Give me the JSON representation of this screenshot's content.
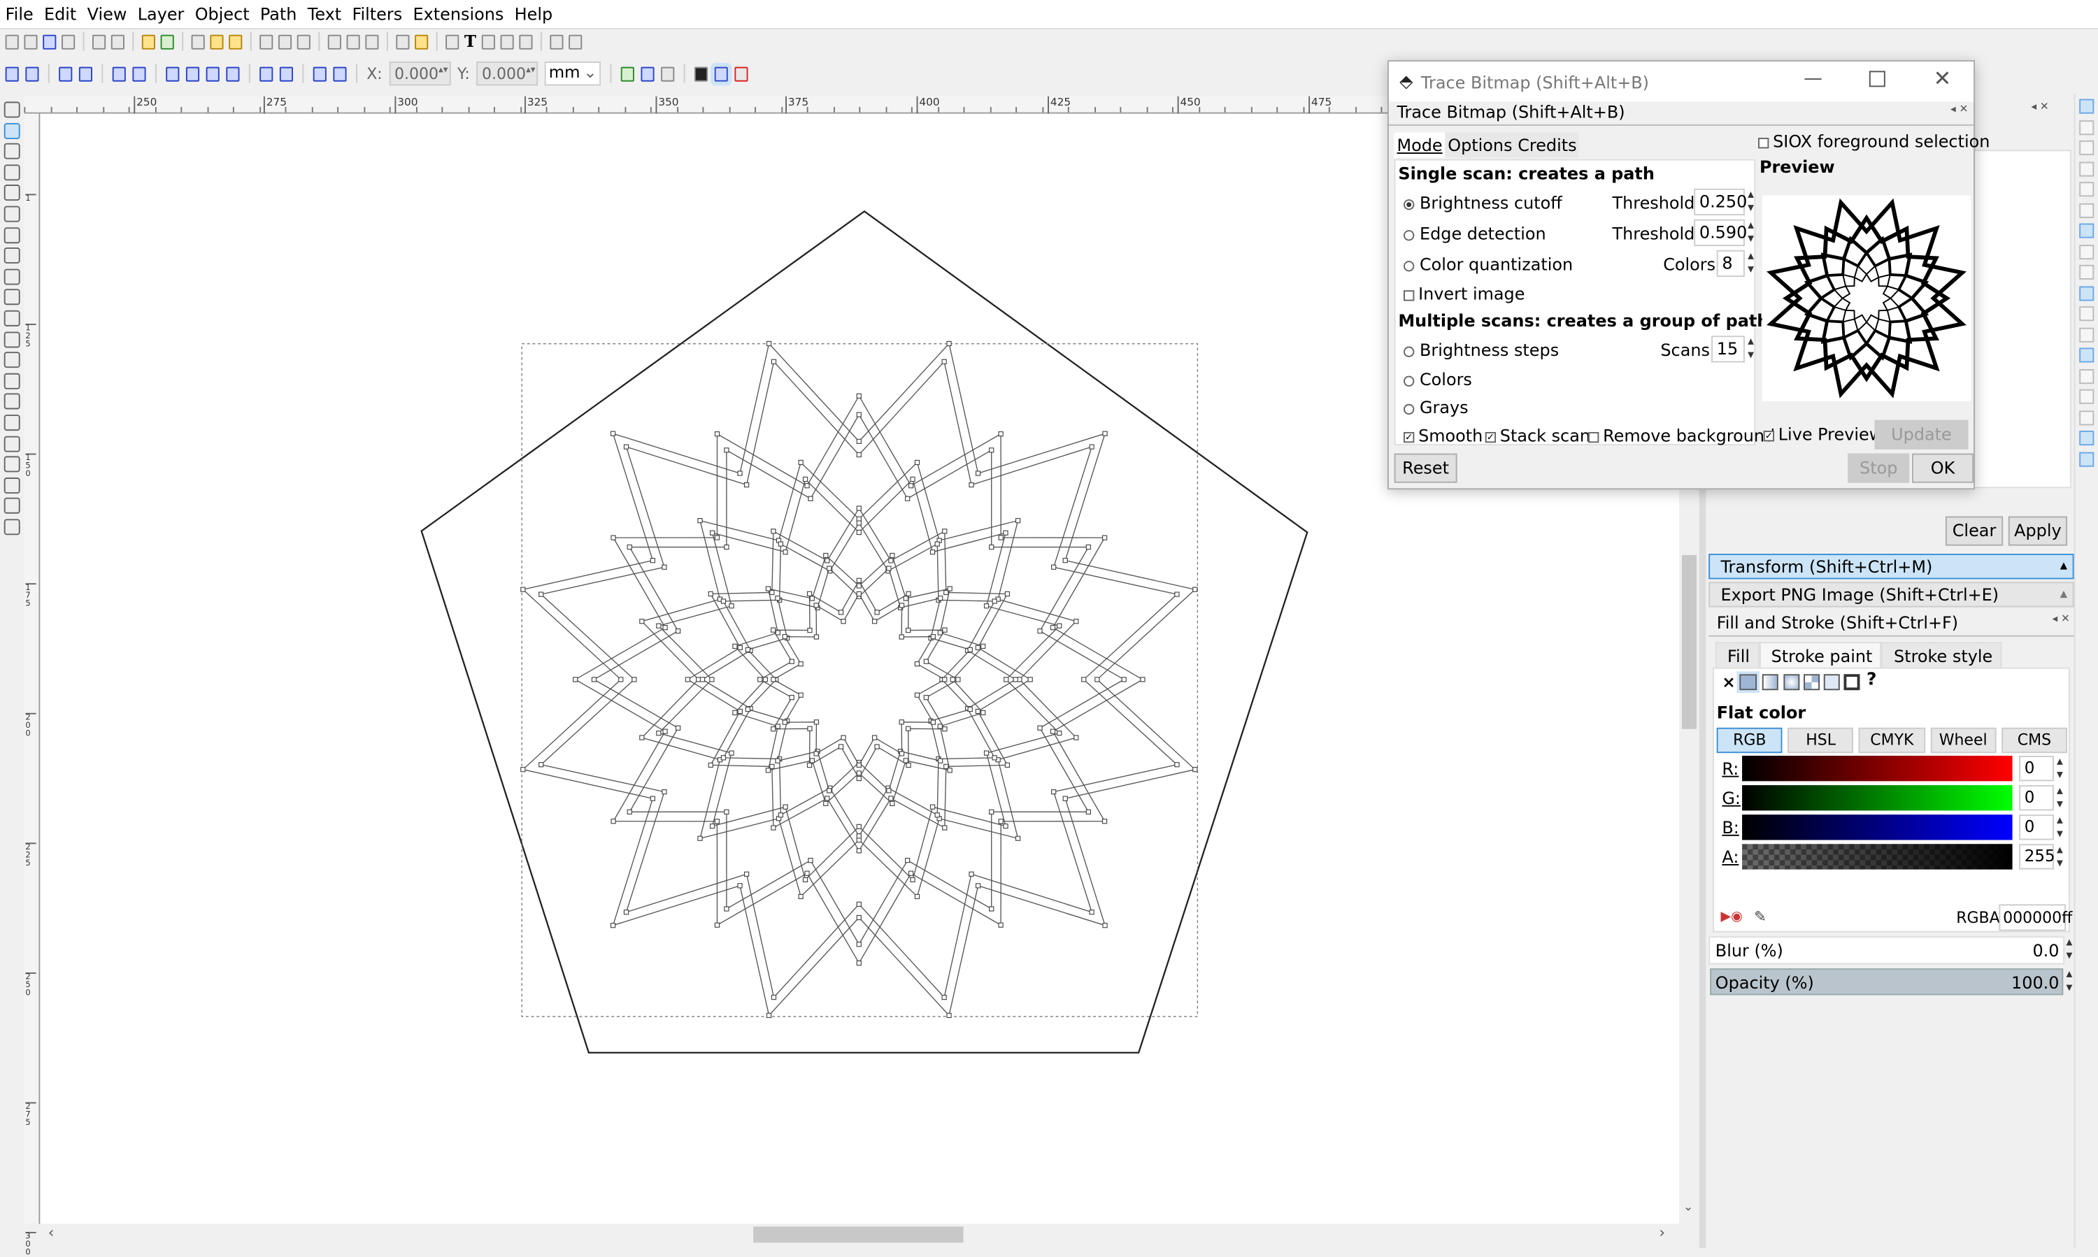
{
  "menu": [
    "File",
    "Edit",
    "View",
    "Layer",
    "Object",
    "Path",
    "Text",
    "Filters",
    "Extensions",
    "Help"
  ],
  "node_toolbar": {
    "x_label": "X:",
    "x_value": "0.000",
    "y_label": "Y:",
    "y_value": "0.000",
    "unit": "mm"
  },
  "ruler": {
    "h_labels": [
      "250",
      "275",
      "300",
      "325",
      "350",
      "375",
      "400",
      "425",
      "450",
      "475"
    ],
    "v_labels": [
      "1",
      "1 2 5",
      "1 5 0",
      "1 7 5",
      "2 0 0",
      "2 2 5",
      "2 5 0",
      "2 7 5",
      "3 0 0"
    ]
  },
  "trace_dialog": {
    "window_title": "Trace Bitmap (Shift+Alt+B)",
    "dock_title": "Trace Bitmap (Shift+Alt+B)",
    "tabs": [
      "Mode",
      "Options",
      "Credits"
    ],
    "active_tab": "Mode",
    "siox_label": "SIOX foreground selection",
    "siox_checked": false,
    "single_heading": "Single scan: creates a path",
    "brightness_label": "Brightness cutoff",
    "brightness_threshold_label": "Threshold:",
    "brightness_threshold": "0.250",
    "edge_label": "Edge detection",
    "edge_threshold_label": "Threshold:",
    "edge_threshold": "0.590",
    "colorq_label": "Color quantization",
    "colors_label": "Colors:",
    "colors_value": "8",
    "invert_label": "Invert image",
    "invert_checked": false,
    "multi_heading": "Multiple scans: creates a group of paths",
    "bsteps_label": "Brightness steps",
    "scans_label": "Scans:",
    "scans_value": "15",
    "colors_option": "Colors",
    "grays_option": "Grays",
    "selected_mode": "Brightness cutoff",
    "smooth_label": "Smooth",
    "smooth_checked": true,
    "stack_label": "Stack scans",
    "stack_checked": true,
    "removebg_label": "Remove background",
    "removebg_checked": false,
    "preview_heading": "Preview",
    "live_preview_label": "Live Preview",
    "live_preview_checked": true,
    "update_button": "Update",
    "reset_button": "Reset",
    "stop_button": "Stop",
    "ok_button": "OK"
  },
  "panel": {
    "clear_button": "Clear",
    "apply_button": "Apply",
    "transform_title": "Transform (Shift+Ctrl+M)",
    "export_title": "Export PNG Image (Shift+Ctrl+E)",
    "fill_stroke_title": "Fill and Stroke (Shift+Ctrl+F)",
    "tabs": [
      "Fill",
      "Stroke paint",
      "Stroke style"
    ],
    "active_tab": "Stroke paint",
    "paint_type_unknown": "?",
    "flat_color_label": "Flat color",
    "color_modes": [
      "RGB",
      "HSL",
      "CMYK",
      "Wheel",
      "CMS"
    ],
    "active_mode": "RGB",
    "channels": [
      {
        "label": "R:",
        "value": "0",
        "color": "#ff0000"
      },
      {
        "label": "G:",
        "value": "0",
        "color": "#00ff00"
      },
      {
        "label": "B:",
        "value": "0",
        "color": "#0000ff"
      },
      {
        "label": "A:",
        "value": "255",
        "color": "#000000"
      }
    ],
    "rgba_label": "RGBA:",
    "rgba_value": "000000ff",
    "blur_label": "Blur (%)",
    "blur_value": "0.0",
    "opacity_label": "Opacity (%)",
    "opacity_value": "100.0"
  },
  "colors": {
    "accent": "#cce4f7",
    "accent_border": "#3c8fd8",
    "opacity_bar": "#b9c4cc"
  }
}
